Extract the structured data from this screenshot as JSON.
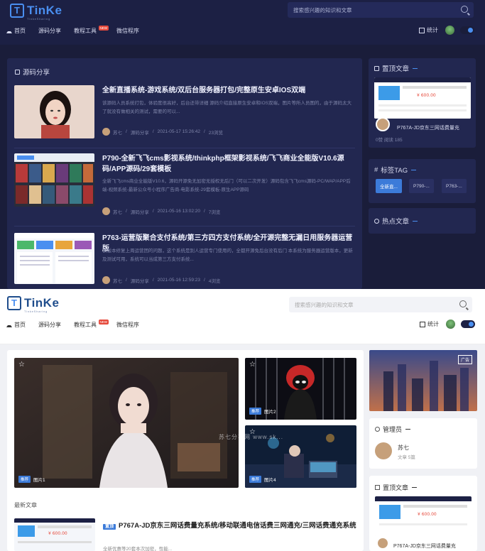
{
  "dark": {
    "logo": {
      "word": "TinKe",
      "sub": "TinkeSharing"
    },
    "search_placeholder": "搜索感兴趣的知识和文章",
    "nav": [
      {
        "label": "首页"
      },
      {
        "label": "源码分享"
      },
      {
        "label": "教程工具",
        "badge": "NEW"
      },
      {
        "label": "微信程序"
      }
    ],
    "stats_label": "统计",
    "main": {
      "title": "源码分享",
      "posts": [
        {
          "title": "全新直播系统-游戏系统/双后台服务器打包/完整原生安卓IOS双端",
          "excerpt": "该源码人员系统打包，体验度很高好，后台还带详细 源码介绍直接原生安卓和IOS双端，图片等所人员图的，由于源码太大了就没有做相关的测试，需要的可以...",
          "author": "苏七",
          "category": "源码分享",
          "date": "2021-05-17 15:26:42",
          "views": "23浏览"
        },
        {
          "title": "P790-全新飞飞cms影视系统/thinkphp框架影视系统/飞飞商业全能版V10.6源码/APP源码/29套模板",
          "excerpt": "全新飞飞cms商业全能版V10.6，源码开源免无加密无授权无后门（可以二次开发）源码包含飞飞cms源码-PC/WAP/APP后端-视频系统-最新公众号小程序广告商-电影系统-29套模板-原生APP源码",
          "author": "苏七",
          "category": "源码分享",
          "date": "2021-05-16 13:02:20",
          "views": "7浏览"
        },
        {
          "title": "P763-运营版聚合支付系统/第三方四方支付系统/全开源完整无漏日用服务器运营版",
          "excerpt": "该版本修复上周运营团的问题，这个系统是别人运营专门使用的，全都开源免后台没有后门 本系统为服务器运营版本，更新及测试可用，系统可以当成第三方支付系统...",
          "author": "苏七",
          "category": "源码分享",
          "date": "2021-05-16 12:59:23",
          "views": "4浏览"
        }
      ]
    },
    "sidebar": {
      "top_title": "置顶文章",
      "top_card_title": "P767A-JD京东三网话费量充",
      "top_card_meta": "0赞 阅读 185",
      "tags_title": "标签TAG",
      "tags": [
        "全新直...",
        "P790-...",
        "P763-..."
      ],
      "hot_title": "热点文章"
    }
  },
  "light": {
    "logo": {
      "word": "TinKe",
      "sub": "TinkeSharing"
    },
    "search_placeholder": "搜索感兴趣的知识和文章",
    "nav": [
      {
        "label": "首页"
      },
      {
        "label": "源码分享"
      },
      {
        "label": "教程工具",
        "badge": "NEW"
      },
      {
        "label": "微信程序"
      }
    ],
    "stats_label": "统计",
    "slides": [
      {
        "tag": "推荐",
        "label": "图片1"
      },
      {
        "tag": "推荐",
        "label": "图片2"
      },
      {
        "tag": "推荐",
        "label": "图片4"
      }
    ],
    "watermark": "苏七分享网 www.sk...",
    "recent_label": "最新文章",
    "recent_post": {
      "badge": "置顶",
      "title": "P767A-JD京东三网话费量充系统/移动联通电信话费三网通充/三网话费通充系统",
      "excerpt": "全新优惠等20套本次加密，性能..."
    },
    "sidebar": {
      "corner_label": "广告",
      "admin_title": "管理员",
      "admin_name": "苏七",
      "admin_sub": "文章 5篇",
      "top_title": "置顶文章",
      "top_card_title": "P767A-JD京东三网话费量充"
    }
  },
  "colors": {
    "dark_bg": "#1a1d3a",
    "dark_panel": "#222750",
    "accent": "#3c7bd9",
    "badge_red": "#e64a3c"
  }
}
